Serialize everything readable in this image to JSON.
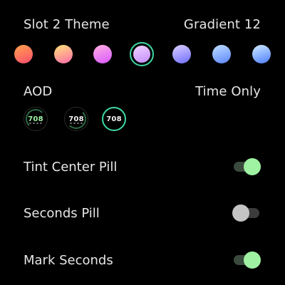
{
  "theme": {
    "label": "Slot 2 Theme",
    "value": "Gradient 12",
    "swatches": [
      {
        "name": "swatch-red-orange",
        "from": "#ffa24d",
        "to": "#ff4d6d"
      },
      {
        "name": "swatch-pink-yellow",
        "from": "#ffe37a",
        "to": "#ff6aa8"
      },
      {
        "name": "swatch-pink-magenta",
        "from": "#ffb0e0",
        "to": "#d957ff"
      },
      {
        "name": "swatch-lavender",
        "from": "#f0d3ff",
        "to": "#c58dff"
      },
      {
        "name": "swatch-periwinkle",
        "from": "#dccfff",
        "to": "#6e6dff"
      },
      {
        "name": "swatch-light-blue",
        "from": "#bfe0ff",
        "to": "#5c85ff"
      },
      {
        "name": "swatch-sky-blue",
        "from": "#d0ecff",
        "to": "#4c7dff"
      }
    ],
    "selected_index": 3,
    "accent": "#3fd8a6"
  },
  "aod": {
    "label": "AOD",
    "value": "Time Only",
    "faces": [
      {
        "name": "aod-face-full",
        "number": "708",
        "style": "full"
      },
      {
        "name": "aod-face-minimal",
        "number": "708",
        "style": "minimal"
      },
      {
        "name": "aod-face-time-only",
        "number": "708",
        "style": "time-only"
      }
    ],
    "selected_index": 2
  },
  "settings": [
    {
      "name": "tint-center-pill",
      "label": "Tint Center Pill",
      "state": "on"
    },
    {
      "name": "seconds-pill",
      "label": "Seconds Pill",
      "state": "off"
    },
    {
      "name": "mark-seconds",
      "label": "Mark Seconds",
      "state": "on"
    }
  ]
}
